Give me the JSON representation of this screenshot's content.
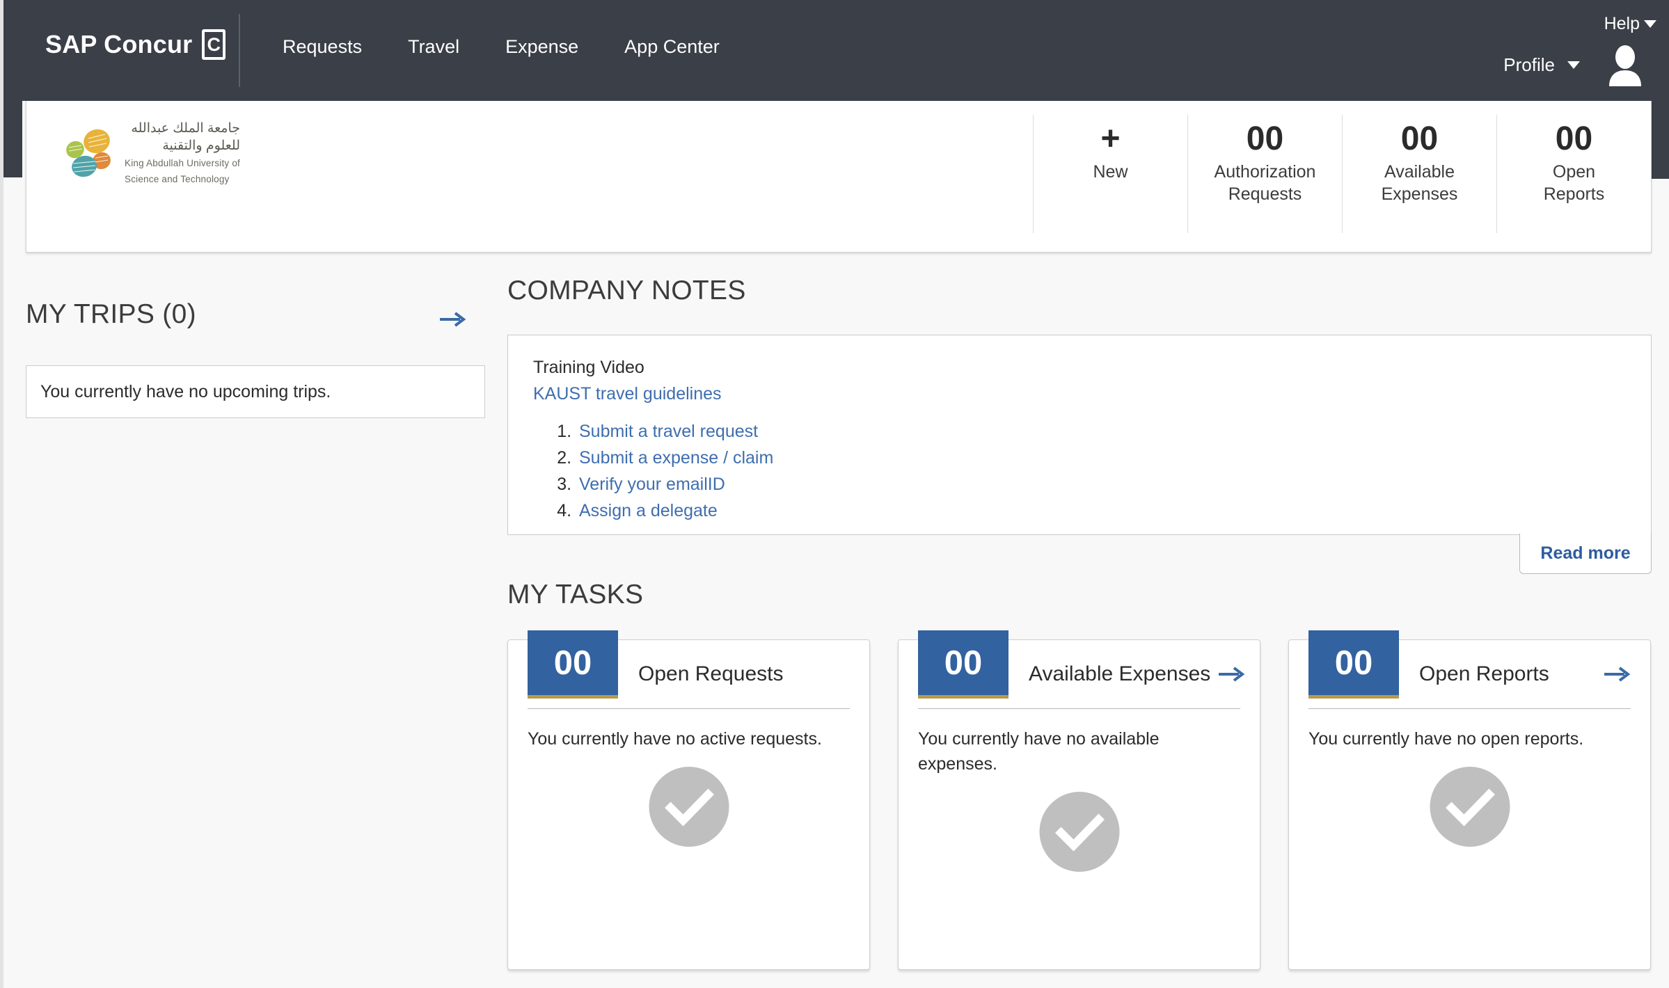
{
  "topnav": {
    "brand": "SAP Concur",
    "brand_mark": "C",
    "items": [
      {
        "label": "Requests"
      },
      {
        "label": "Travel"
      },
      {
        "label": "Expense"
      },
      {
        "label": "App Center"
      }
    ],
    "help_label": "Help",
    "profile_label": "Profile",
    "avatar_icon": "user-avatar-icon",
    "caret_icon": "caret-down-icon",
    "bar_color": "#3a3f48"
  },
  "company_logo": {
    "arabic_line_1": "جامعة الملك عبدالله",
    "arabic_line_2": "للعلوم والتقنية",
    "english_line_1": "King Abdullah University of",
    "english_line_2": "Science and Technology",
    "colors": {
      "gold": "#e8b33a",
      "green": "#a9c44b",
      "orange": "#e08a3c",
      "teal": "#4fa3a8"
    }
  },
  "quick_actions": [
    {
      "value": "+",
      "label": "New",
      "icon": "plus-icon"
    },
    {
      "value": "00",
      "label_line_1": "Authorization",
      "label_line_2": "Requests"
    },
    {
      "value": "00",
      "label_line_1": "Available",
      "label_line_2": "Expenses"
    },
    {
      "value": "00",
      "label_line_1": "Open",
      "label_line_2": "Reports"
    }
  ],
  "my_trips": {
    "title": "MY TRIPS (0)",
    "arrow_icon": "arrow-right-icon",
    "empty_message": "You currently have no upcoming trips."
  },
  "company_notes": {
    "title": "COMPANY NOTES",
    "heading": "Training Video",
    "main_link": "KAUST travel guidelines",
    "list": [
      {
        "label": "Submit a travel request"
      },
      {
        "label": "Submit a expense / claim"
      },
      {
        "label": "Verify your emailID"
      },
      {
        "label": "Assign a delegate"
      }
    ],
    "read_more_label": "Read more",
    "link_color": "#3e6eae"
  },
  "my_tasks": {
    "title": "MY TASKS",
    "cards": [
      {
        "count": "00",
        "title": "Open Requests",
        "message": "You currently have no active requests.",
        "has_arrow": false,
        "status_icon": "check-circle-icon"
      },
      {
        "count": "00",
        "title": "Available Expenses",
        "message": "You currently have no available expenses.",
        "has_arrow": true,
        "status_icon": "check-circle-icon"
      },
      {
        "count": "00",
        "title": "Open Reports",
        "message": "You currently have no open reports.",
        "has_arrow": true,
        "status_icon": "check-circle-icon"
      }
    ],
    "badge_color": "#32629f",
    "badge_underline_color": "#b79a4a"
  }
}
